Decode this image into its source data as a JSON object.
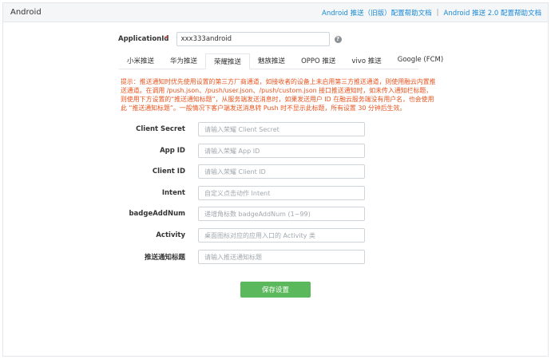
{
  "header": {
    "title": "Android",
    "links": [
      "Android 推送（旧版）配置帮助文档",
      "Android 推送 2.0 配置帮助文档"
    ],
    "separator": "|"
  },
  "app": {
    "label": "ApplicationId",
    "required_mark": "*",
    "value": "xxx333android",
    "help_icon": "question-circle-icon"
  },
  "tabs": [
    "小米推送",
    "华为推送",
    "荣耀推送",
    "魅族推送",
    "OPPO 推送",
    "vivo 推送",
    "Google (FCM)"
  ],
  "active_tab": "荣耀推送",
  "notice": "提示：推送通知时优先使用设置的第三方厂商通道，如接收者的设备上未启用第三方推送通道，则使用融云内置推送通道。在调用 /push.json、/push/user.json、/push/custom.json 接口推送通知时，如未传入通知栏标题，则使用下方设置的“推送通知标题”，从服务端发送消息时，如果发送用户 ID 在融云服务端没有用户名，也会使用此 “推送通知标题”。一般情况下客户端发送消息转 Push 时不显示此标题，所有设置 30 分钟后生效。",
  "fields": [
    {
      "label": "Client Secret",
      "placeholder": "请输入荣耀 Client Secret"
    },
    {
      "label": "App ID",
      "placeholder": "请输入荣耀 App ID"
    },
    {
      "label": "Client ID",
      "placeholder": "请输入荣耀 Client ID"
    },
    {
      "label": "Intent",
      "placeholder": "自定义点击动作 Intent"
    },
    {
      "label": "badgeAddNum",
      "placeholder": "递增角标数 badgeAddNum (1~99)"
    },
    {
      "label": "Activity",
      "placeholder": "桌面图标对应的应用入口的 Activity 类"
    },
    {
      "label": "推送通知标题",
      "placeholder": "请输入推送通知标题"
    }
  ],
  "save_label": "保存设置",
  "colors": {
    "accent": "#1a8ad6",
    "notice": "#e8541f",
    "save": "#5cb85c",
    "required": "#e53935"
  }
}
